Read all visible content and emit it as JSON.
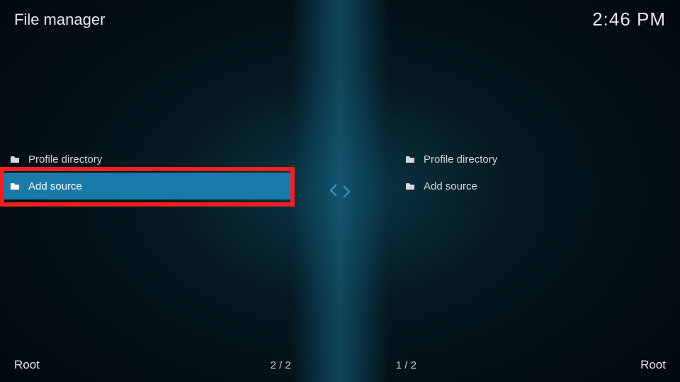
{
  "header": {
    "title": "File manager",
    "clock": "2:46 PM"
  },
  "left_panel": {
    "items": [
      {
        "label": "Profile directory"
      },
      {
        "label": "Add source"
      }
    ],
    "selected_index": 1,
    "path": "Root",
    "counter": "2 / 2"
  },
  "right_panel": {
    "items": [
      {
        "label": "Profile directory"
      },
      {
        "label": "Add source"
      }
    ],
    "path": "Root",
    "counter": "1 / 2"
  },
  "colors": {
    "highlight": "#f02020",
    "selected_bg": "#1a7aa8",
    "accent": "#2b94c4"
  }
}
